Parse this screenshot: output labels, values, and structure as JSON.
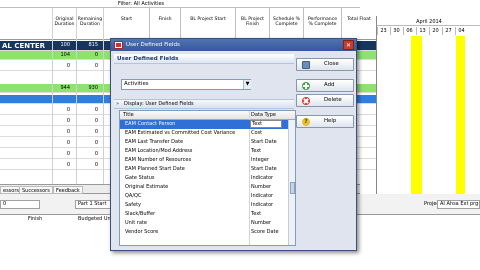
{
  "filter_label": "Filter: All Activities",
  "columns": [
    {
      "label": "Original\nDuration"
    },
    {
      "label": "Remaining\nDuration"
    },
    {
      "label": "Start"
    },
    {
      "label": "Finish"
    },
    {
      "label": "BL Project Start"
    },
    {
      "label": "BL Project\nFinish"
    },
    {
      "label": "Schedule %\nComplete"
    },
    {
      "label": "Performance\n% Complete"
    },
    {
      "label": "Total Float"
    }
  ],
  "grid": {
    "group_label": "AL CENTER",
    "rows": [
      {
        "orig": "100",
        "rem": "815"
      },
      {
        "orig": "104",
        "rem": "0"
      },
      {
        "orig": "0",
        "rem": "0"
      },
      {
        "orig": "944",
        "rem": "930"
      },
      {
        "orig": "0",
        "rem": "0"
      },
      {
        "orig": "0",
        "rem": "0"
      },
      {
        "orig": "0",
        "rem": "0"
      },
      {
        "orig": "0",
        "rem": "0"
      },
      {
        "orig": "0",
        "rem": "0"
      },
      {
        "orig": "0",
        "rem": "0"
      }
    ]
  },
  "gantt": {
    "month": "April 2014",
    "days": [
      "23",
      "30",
      "06",
      "13",
      "20",
      "27",
      "04"
    ]
  },
  "tabs": [
    "essors",
    "Successors",
    "Feedback"
  ],
  "detail": {
    "left_value": "0",
    "mid_value": "Part 1 Start",
    "project_label": "Project",
    "project_value": "AI Ahsa Ext prg-4",
    "headers": [
      "Finish",
      "Budgeted Uni"
    ]
  },
  "dialog": {
    "title": "User Defined Fields",
    "heading": "User Defined Fields",
    "subject_area": "Activities",
    "display_label": "Display: User Defined Fields",
    "list_headers": {
      "title": "Title",
      "type": "Data Type"
    },
    "fields": [
      {
        "title": "EAM Contact Person",
        "type": "Text",
        "selected": true
      },
      {
        "title": "EAM Estimated vs Committed Cost Variance",
        "type": "Cost"
      },
      {
        "title": "EAM Last Transfer Date",
        "type": "Start Date"
      },
      {
        "title": "EAM Location/Mod Address",
        "type": "Text"
      },
      {
        "title": "EAM Number of Resources",
        "type": "Integer"
      },
      {
        "title": "EAM Planned Start Date",
        "type": "Start Date"
      },
      {
        "title": "Gate Status",
        "type": "Indicator"
      },
      {
        "title": "Original Estimate",
        "type": "Number"
      },
      {
        "title": "QA/QC",
        "type": "Indicator"
      },
      {
        "title": "Safety",
        "type": "Indicator"
      },
      {
        "title": "Slack/Buffer",
        "type": "Text"
      },
      {
        "title": "Unit rate",
        "type": "Number"
      },
      {
        "title": "Vendor Score",
        "type": "Score Date"
      }
    ],
    "buttons": {
      "close": "Close",
      "add": "Add",
      "delete": "Delete",
      "help": "Help"
    }
  }
}
